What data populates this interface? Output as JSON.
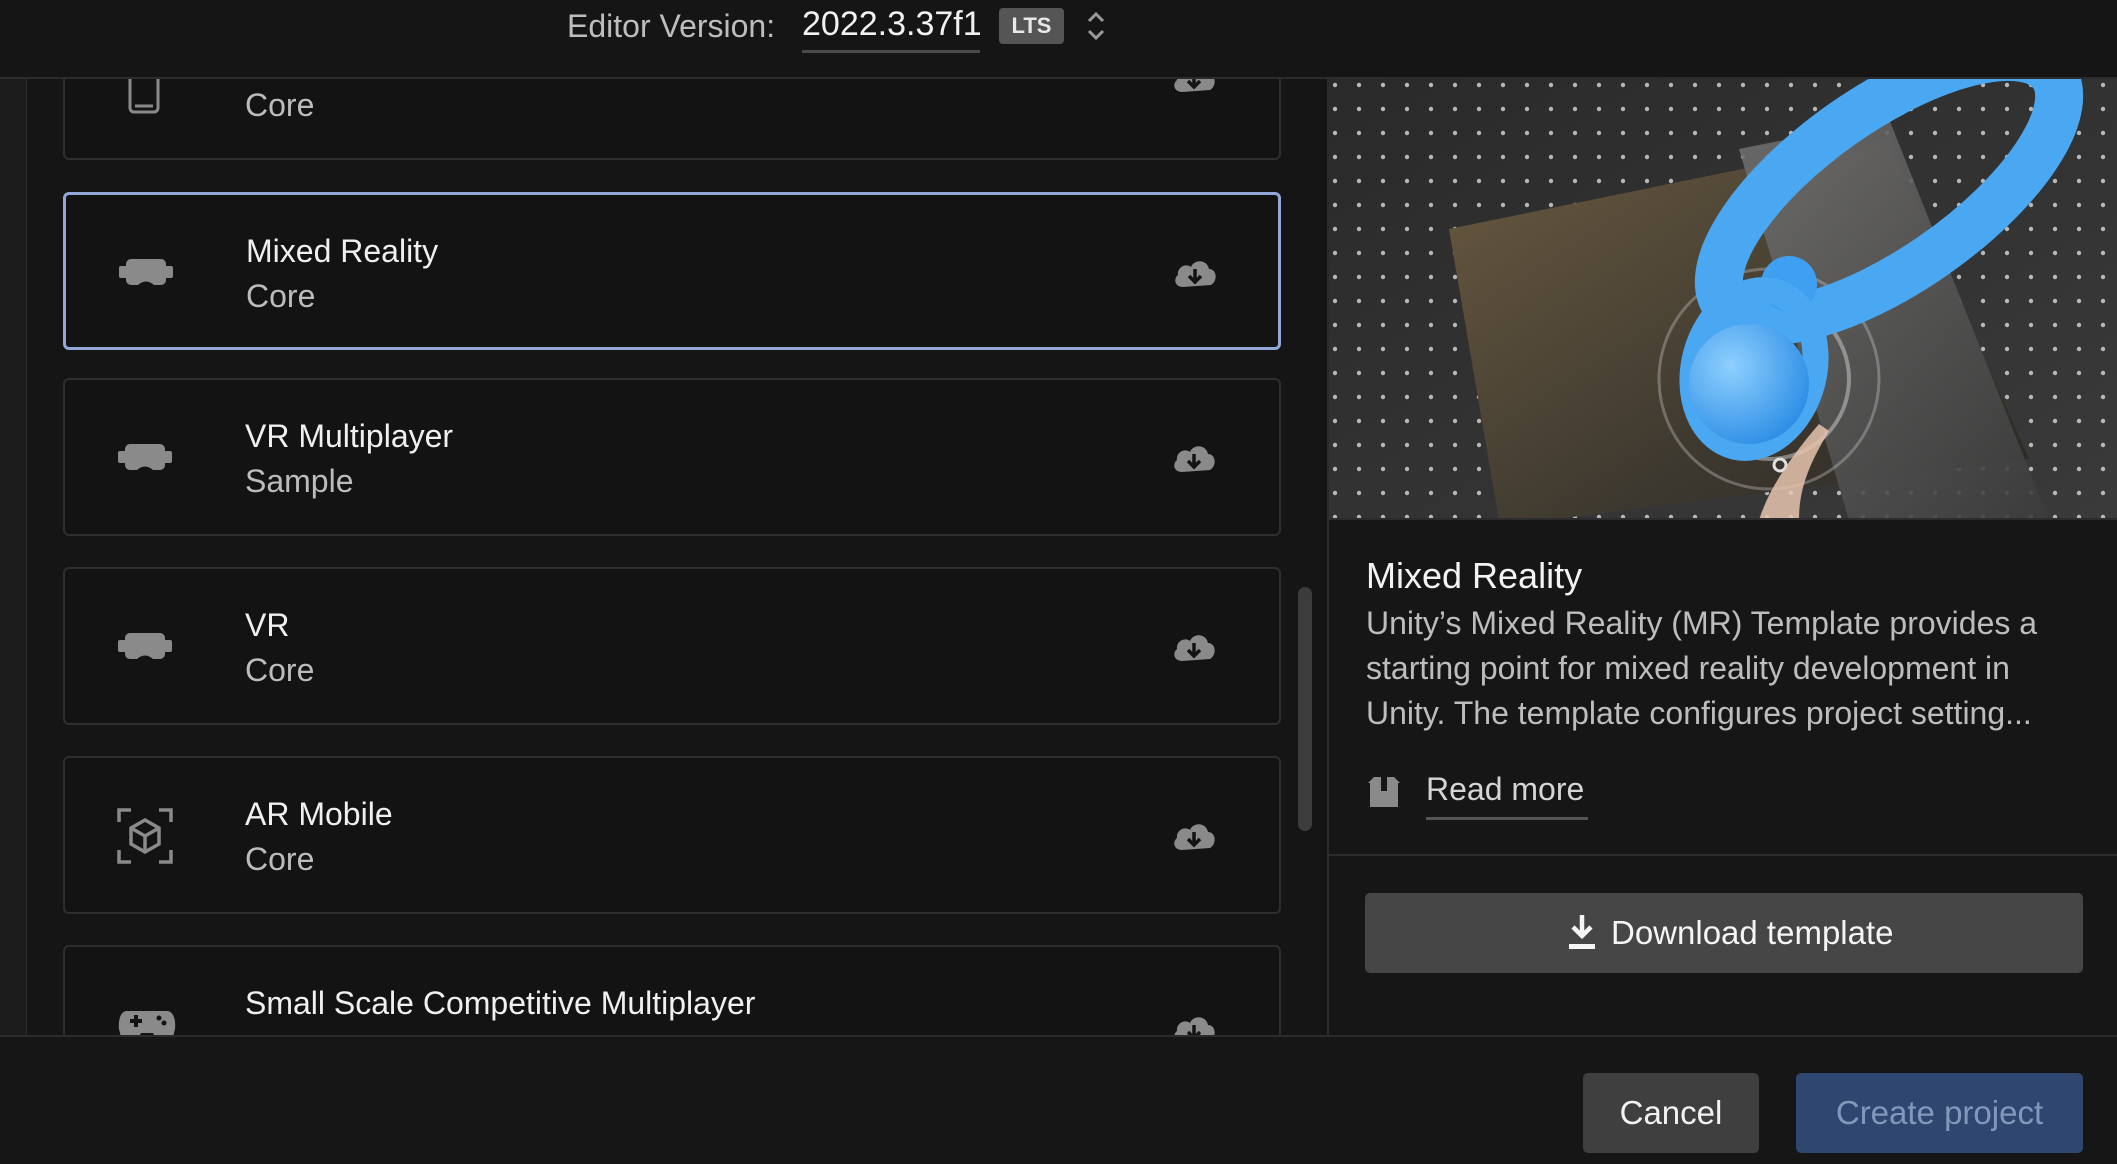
{
  "header": {
    "editor_version_label": "Editor Version:",
    "editor_version": "2022.3.37f1",
    "badge": "LTS"
  },
  "templates": [
    {
      "title": "",
      "subtitle": "Core",
      "icon": "mobile-device-icon"
    },
    {
      "title": "Mixed Reality",
      "subtitle": "Core",
      "icon": "vr-headset-icon",
      "selected": true
    },
    {
      "title": "VR Multiplayer",
      "subtitle": "Sample",
      "icon": "vr-headset-icon"
    },
    {
      "title": "VR",
      "subtitle": "Core",
      "icon": "vr-headset-icon"
    },
    {
      "title": "AR Mobile",
      "subtitle": "Core",
      "icon": "ar-cube-icon"
    },
    {
      "title": "Small Scale Competitive Multiplayer",
      "subtitle": "",
      "icon": "gamepad-icon"
    }
  ],
  "details": {
    "title": "Mixed Reality",
    "description": "Unity’s Mixed Reality (MR) Template provides a starting point for mixed reality development in Unity. The template configures project setting...",
    "read_more": "Read more",
    "download_button": "Download template"
  },
  "footer": {
    "cancel": "Cancel",
    "create": "Create project"
  },
  "colors": {
    "background": "#151515",
    "selected_border": "#93a8d8",
    "create_button": "#2f4770",
    "accent_blue": "#4aa8f2"
  }
}
